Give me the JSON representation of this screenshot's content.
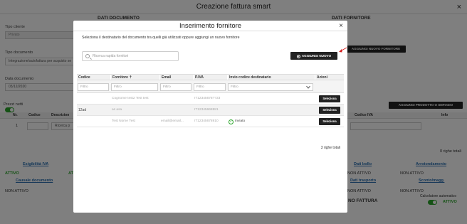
{
  "app": {
    "title": "Creazione fattura smart",
    "close_icon": "×",
    "sections": {
      "documento": "DATI DOCUMENTO",
      "fornitore": "DATI FORNITORE"
    },
    "tipo_cliente_label": "Tipo cliente",
    "tipo_cliente_value": "Privato",
    "tipo_documento_label": "Tipo documento",
    "tipo_documento_value": "Integrazione/autofattura per acquisto se",
    "data_documento_label": "Data documento",
    "data_documento_value": "03/12/2020",
    "prezzi_netti_label": "Prezzi netti",
    "aggiungi_fornitore_btn": "AGGIUNGI NUOVO FORNITORE",
    "aggiungi_prodotto_btn": "AGGIUNGI PRODOTTO O SERVIZIO",
    "righe_headers": {
      "nr": "Nr.",
      "codice": "Codice",
      "descrizione": "Descrizion",
      "codice_iva": "Codice IVA",
      "info": "Info"
    },
    "riga_nr": "1",
    "riga_search_placeholder": "Ricerca p",
    "righe_totali": "0 righe totali",
    "esigibilita_label": "Esigibilità IVA",
    "esigibilita_value": "ATTIVO",
    "causale_label": "Causale documento",
    "causale_value": "NON ATTIVO",
    "bollo_label": "Dati bollo",
    "bollo_value": "NON ATTIVO",
    "arrotondamento_label": "Arrotondamento",
    "arrotondamento_value": "NON ATTIVO",
    "trasporto_label": "Dati trasporto",
    "trasporto_value": "NON ATTIVO",
    "sconto_label": "Sconto/magg.",
    "sconto_value": "NON ATTIVO",
    "totale_fattura_label": "NO FATTURA",
    "calcolatore_label": "Calcolatore automatico",
    "calcolatore_value": "ATTIVO",
    "activo_col_value": "ATTI"
  },
  "modal": {
    "title": "Inserimento fornitore",
    "close_icon": "×",
    "instructions": "Seleziona il destinatario del documento tra quelli già utilizzati oppure aggiungi un nuovo fornitore",
    "search_placeholder": "Ricerca rapida fornitori",
    "add_new_label": "AGGIUNGI NUOVO",
    "columns": [
      "Codice",
      "Fornitore ⇡",
      "Email",
      "P.IVA",
      "Invio codice destinatario",
      "Azioni"
    ],
    "filter_placeholder": "Filtro",
    "rows": [
      {
        "codice": "",
        "fornitore": "Cognome test2 Test test",
        "email": "",
        "piva": "IT12345678??23",
        "invio": "",
        "invio_icon": "",
        "azione": "Seleziona"
      },
      {
        "codice": "12ad",
        "fornitore": "as asa",
        "email": "",
        "piva": "IT12345668881",
        "invio": "",
        "invio_icon": "",
        "azione": "Seleziona"
      },
      {
        "codice": "",
        "fornitore": "Test Nome Test",
        "email": "email@email...",
        "piva": "IT12345678910",
        "invio": "Inviato",
        "invio_icon": "✓",
        "azione": "Seleziona"
      }
    ],
    "total_label": "3 righe totali"
  }
}
